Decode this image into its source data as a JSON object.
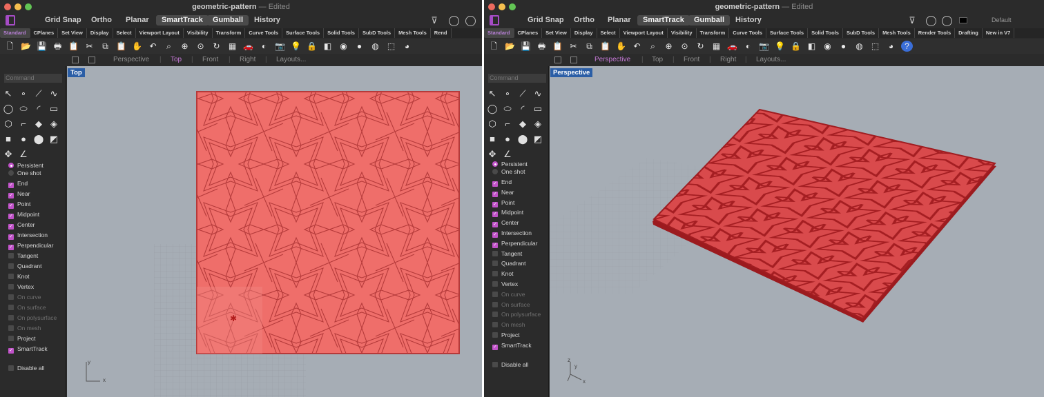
{
  "document": {
    "title": "geometric-pattern",
    "status": "Edited"
  },
  "mainbar": {
    "toggles": [
      "Grid Snap",
      "Ortho",
      "Planar",
      "SmartTrack",
      "Gumball",
      "History"
    ],
    "active_toggles": [
      "SmartTrack",
      "Gumball"
    ],
    "layer_name": "Default"
  },
  "tabs_left": [
    "Standard",
    "CPlanes",
    "Set View",
    "Display",
    "Select",
    "Viewport Layout",
    "Visibility",
    "Transform",
    "Curve Tools",
    "Surface Tools",
    "Solid Tools",
    "SubD Tools",
    "Mesh Tools",
    "Rend"
  ],
  "tabs_right": [
    "Standard",
    "CPlanes",
    "Set View",
    "Display",
    "Select",
    "Viewport Layout",
    "Visibility",
    "Transform",
    "Curve Tools",
    "Surface Tools",
    "Solid Tools",
    "SubD Tools",
    "Mesh Tools",
    "Render Tools",
    "Drafting",
    "New in V7"
  ],
  "view_tabs": [
    "Perspective",
    "Top",
    "Front",
    "Right",
    "Layouts..."
  ],
  "left_window": {
    "active_view_tab": "Top",
    "viewport_label": "Top",
    "axes": [
      "y",
      "x"
    ]
  },
  "right_window": {
    "active_view_tab": "Perspective",
    "viewport_label": "Perspective",
    "axes": [
      "z",
      "y",
      "x"
    ]
  },
  "command_placeholder": "Command",
  "osnap": {
    "modes": [
      {
        "label": "Persistent",
        "selected": true
      },
      {
        "label": "One shot",
        "selected": false
      }
    ],
    "items": [
      {
        "label": "End",
        "checked": true,
        "enabled": true
      },
      {
        "label": "Near",
        "checked": true,
        "enabled": true
      },
      {
        "label": "Point",
        "checked": true,
        "enabled": true
      },
      {
        "label": "Midpoint",
        "checked": true,
        "enabled": true
      },
      {
        "label": "Center",
        "checked": true,
        "enabled": true
      },
      {
        "label": "Intersection",
        "checked": true,
        "enabled": true
      },
      {
        "label": "Perpendicular",
        "checked": true,
        "enabled": true
      },
      {
        "label": "Tangent",
        "checked": false,
        "enabled": true
      },
      {
        "label": "Quadrant",
        "checked": false,
        "enabled": true
      },
      {
        "label": "Knot",
        "checked": false,
        "enabled": true
      },
      {
        "label": "Vertex",
        "checked": false,
        "enabled": true
      },
      {
        "label": "On curve",
        "checked": false,
        "enabled": false
      },
      {
        "label": "On surface",
        "checked": false,
        "enabled": false
      },
      {
        "label": "On polysurface",
        "checked": false,
        "enabled": false
      },
      {
        "label": "On mesh",
        "checked": false,
        "enabled": false
      },
      {
        "label": "Project",
        "checked": false,
        "enabled": true
      },
      {
        "label": "SmartTrack",
        "checked": true,
        "enabled": true
      }
    ],
    "disable_all": "Disable all"
  },
  "toolbar_icons": [
    "new-icon",
    "open-icon",
    "save-icon",
    "print-icon",
    "paste-special-icon",
    "cut-icon",
    "copy-icon",
    "paste-icon",
    "pan-hand-icon",
    "undo-icon",
    "zoom-window-icon",
    "zoom-extents-icon",
    "zoom-selected-icon",
    "rotate-view-icon",
    "grid-icon",
    "car-icon",
    "shade-icon",
    "camera-icon",
    "light-bulb-icon",
    "lock-icon",
    "layer-icon",
    "color-wheel-icon",
    "sphere-render-icon",
    "sphere-material-icon",
    "filter-icon",
    "viewport-icon",
    "help-icon"
  ],
  "colors": {
    "accent": "#c152c9",
    "pattern_fill": "#ef6e6a",
    "pattern_line": "#b53a3a",
    "solid_red": "#c0262a",
    "viewport_bg": "#a6adb5"
  }
}
